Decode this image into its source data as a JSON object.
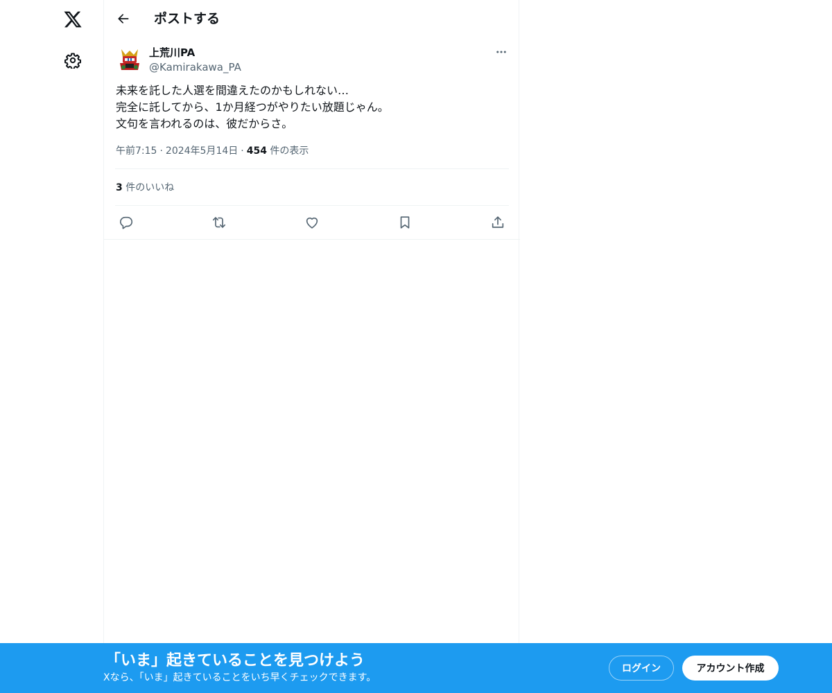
{
  "header": {
    "title": "ポストする"
  },
  "post": {
    "author_name": "上荒川PA",
    "author_handle": "@Kamirakawa_PA",
    "text_lines": [
      "未来を託した人選を間違えたのかもしれない…",
      "完全に託してから、1か月経つがやりたい放題じゃん。",
      "文句を言われるのは、彼だからさ。"
    ],
    "time": "午前7:15",
    "date": "2024年5月14日",
    "separator": "·",
    "views_count": "454",
    "views_label": "件の表示",
    "likes_count": "3",
    "likes_label": "件のいいね"
  },
  "banner": {
    "title": "「いま」起きていることを見つけよう",
    "subtitle": "Xなら、「いま」起きていることをいち早くチェックできます。",
    "login_label": "ログイン",
    "signup_label": "アカウント作成"
  },
  "colors": {
    "accent": "#1d9bf0",
    "text_primary": "#0f1419",
    "text_secondary": "#536471",
    "border": "#eff3f4"
  },
  "icons": {
    "nav_logo": "x-logo-icon",
    "nav_settings": "gear-icon",
    "back": "arrow-left-icon",
    "more": "more-horizontal-icon",
    "reply": "reply-icon",
    "repost": "repost-icon",
    "like": "heart-icon",
    "bookmark": "bookmark-icon",
    "share": "share-icon"
  }
}
